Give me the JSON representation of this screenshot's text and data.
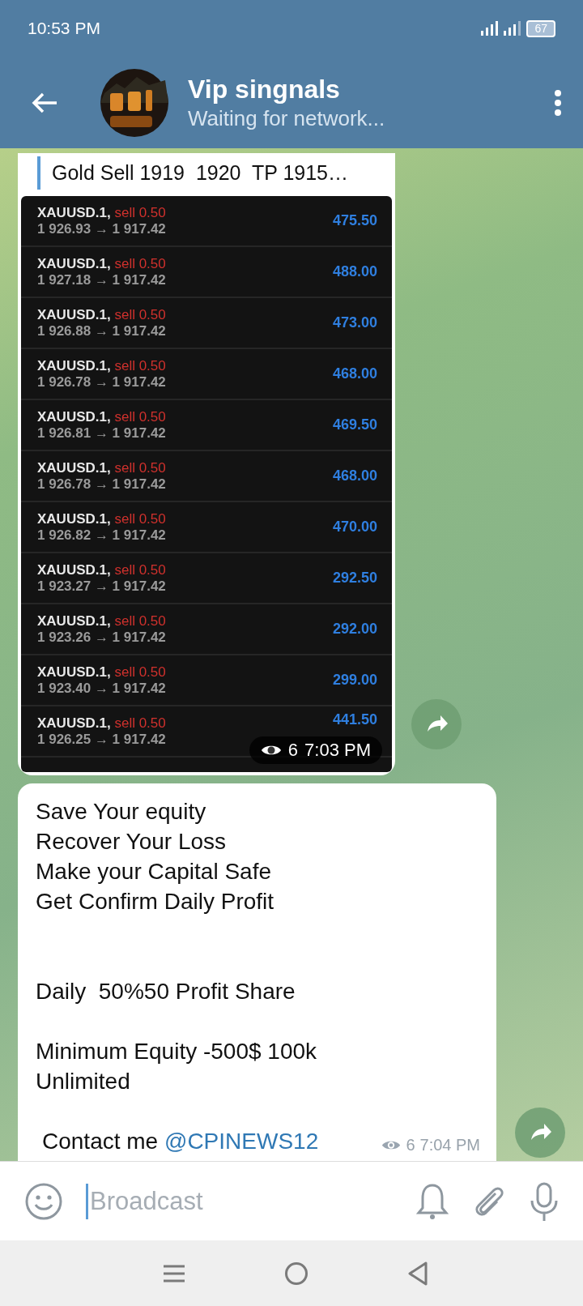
{
  "status_bar": {
    "time": "10:53 PM",
    "battery": "67"
  },
  "header": {
    "title": "Vip singnals",
    "subtitle": "Waiting for network..."
  },
  "messages": [
    {
      "kind": "screenshot",
      "quote": "Gold Sell 1919  1920  TP 1915…",
      "views": "6",
      "time": "7:03 PM",
      "trades": [
        {
          "symbol": "XAUUSD.1,",
          "side": "sell 0.50",
          "prices": "1 926.93 → 1 917.42",
          "profit": "475.50"
        },
        {
          "symbol": "XAUUSD.1,",
          "side": "sell 0.50",
          "prices": "1 927.18 → 1 917.42",
          "profit": "488.00"
        },
        {
          "symbol": "XAUUSD.1,",
          "side": "sell 0.50",
          "prices": "1 926.88 → 1 917.42",
          "profit": "473.00"
        },
        {
          "symbol": "XAUUSD.1,",
          "side": "sell 0.50",
          "prices": "1 926.78 → 1 917.42",
          "profit": "468.00"
        },
        {
          "symbol": "XAUUSD.1,",
          "side": "sell 0.50",
          "prices": "1 926.81 → 1 917.42",
          "profit": "469.50"
        },
        {
          "symbol": "XAUUSD.1,",
          "side": "sell 0.50",
          "prices": "1 926.78 → 1 917.42",
          "profit": "468.00"
        },
        {
          "symbol": "XAUUSD.1,",
          "side": "sell 0.50",
          "prices": "1 926.82 → 1 917.42",
          "profit": "470.00"
        },
        {
          "symbol": "XAUUSD.1,",
          "side": "sell 0.50",
          "prices": "1 923.27 → 1 917.42",
          "profit": "292.50"
        },
        {
          "symbol": "XAUUSD.1,",
          "side": "sell 0.50",
          "prices": "1 923.26 → 1 917.42",
          "profit": "292.00"
        },
        {
          "symbol": "XAUUSD.1,",
          "side": "sell 0.50",
          "prices": "1 923.40 → 1 917.42",
          "profit": "299.00"
        },
        {
          "symbol": "XAUUSD.1,",
          "side": "sell 0.50",
          "prices": "1 926.25 → 1 917.42",
          "profit": "441.50"
        }
      ]
    },
    {
      "kind": "text",
      "paragraphs": [
        [
          "Save Your equity",
          "Recover Your Loss",
          "Make your Capital Safe",
          "Get Confirm Daily Profit"
        ],
        [
          "Daily  50%50 Profit Share"
        ],
        [
          "Minimum Equity -500$ 100k",
          "Unlimited"
        ]
      ],
      "contact_label": "Contact me",
      "contact_link": "@CPINEWS12",
      "views": "6",
      "time": "7:04 PM"
    }
  ],
  "composer": {
    "placeholder": "Broadcast"
  }
}
